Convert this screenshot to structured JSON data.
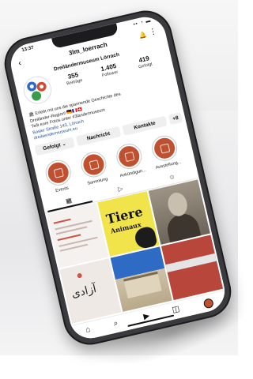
{
  "status": {
    "time": "13:37",
    "icons": "▪▪ ◔ ▬"
  },
  "topbar": {
    "back": "‹",
    "username": "3lm_loerrach",
    "notifications": "🔔",
    "more": "⋮"
  },
  "profile": {
    "name": "Dreiländermuseum Lörrach",
    "stats": [
      {
        "value": "355",
        "label": "Beiträge"
      },
      {
        "value": "1.405",
        "label": "Follower"
      },
      {
        "value": "419",
        "label": "Gefolgt"
      }
    ]
  },
  "bio": {
    "line1": "🏛 Erlebt mit uns die spannende Geschichte des",
    "line2": "Dreiländer-Region! 🇩🇪🇫🇷🇨🇭",
    "line3": "Teilt eure Fotos unter #3landermuseum",
    "line4": "Basler Straße 143, Lörrach",
    "link": "dreilaendermuseum.eu"
  },
  "buttons": {
    "following": "Gefolgt ⌄",
    "message": "Nachricht",
    "contacts": "Kontakte",
    "add_person": "+8"
  },
  "highlights": [
    {
      "label": "Events"
    },
    {
      "label": "Sammlung"
    },
    {
      "label": "Ankündigun..."
    },
    {
      "label": "Ausstellung..."
    }
  ],
  "tabs": [
    {
      "icon": "▦"
    },
    {
      "icon": "▷"
    },
    {
      "icon": "☺"
    }
  ],
  "grid": {
    "post2_title": "Tiere",
    "post2_sub": "Animaux",
    "post4_script": "آزادی"
  },
  "nav": {
    "home": "⌂",
    "search": "⌕",
    "reels": "▶",
    "shop": "◫"
  },
  "colors": {
    "highlight": "#c0502f",
    "accent_link": "#1f4f93",
    "poster_yellow": "#f1e34a"
  }
}
